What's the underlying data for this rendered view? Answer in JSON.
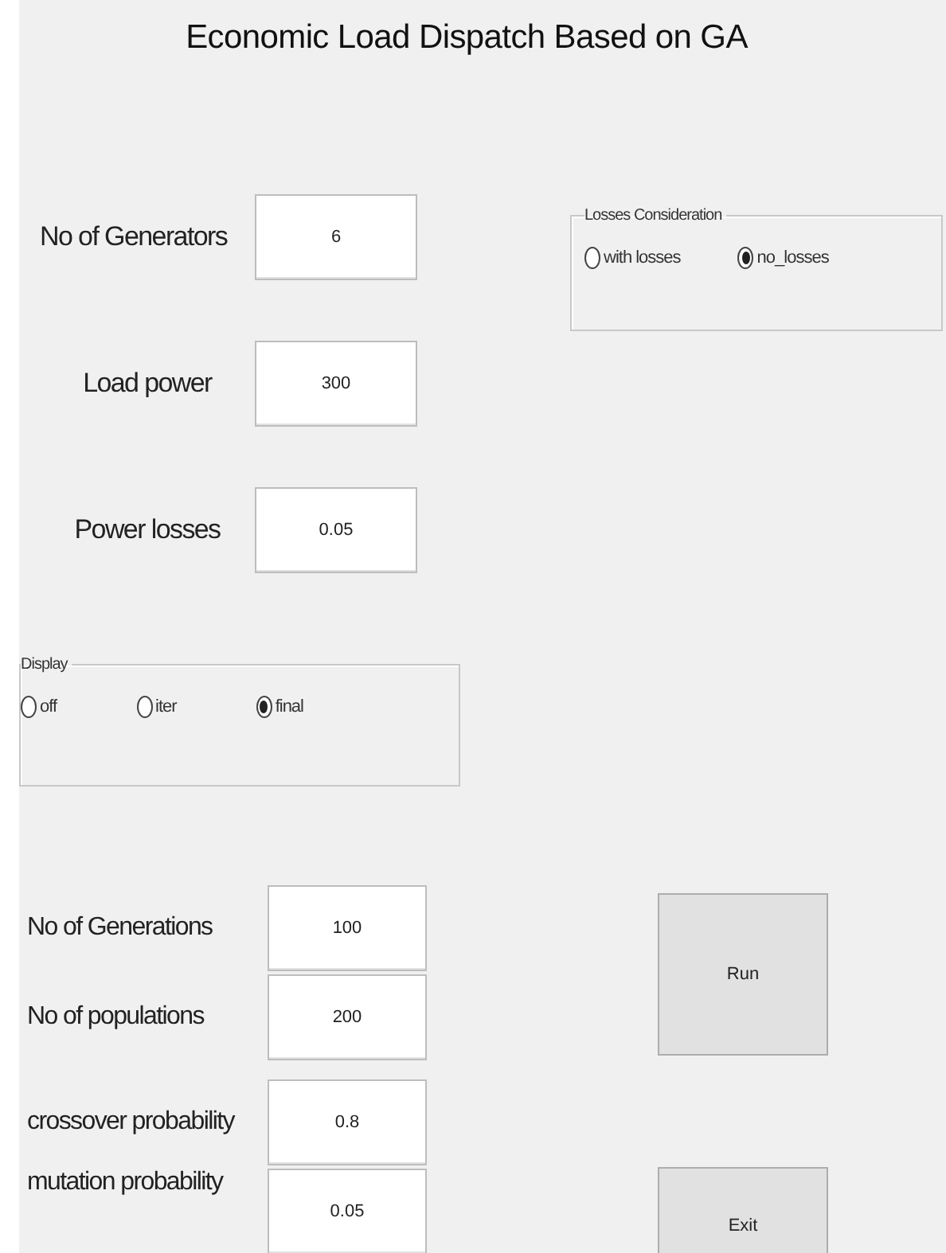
{
  "title": "Economic Load Dispatch Based on GA",
  "system_fields": [
    {
      "label": "No of Generators",
      "value": "6"
    },
    {
      "label": "Load power",
      "value": "300"
    },
    {
      "label": "Power losses",
      "value": "0.05"
    }
  ],
  "losses_consideration": {
    "title": "Losses Consideration",
    "options": [
      {
        "label": "with losses",
        "selected": false
      },
      {
        "label": "no_losses",
        "selected": true
      }
    ]
  },
  "display": {
    "title": "Display",
    "options": [
      {
        "label": "off",
        "selected": false
      },
      {
        "label": "iter",
        "selected": false
      },
      {
        "label": "final",
        "selected": true
      }
    ]
  },
  "ga_fields": [
    {
      "label": "No of Generations",
      "value": "100"
    },
    {
      "label": "No of populations",
      "value": "200"
    },
    {
      "label": "crossover probability",
      "value": "0.8"
    },
    {
      "label": "mutation probability",
      "value": "0.05"
    }
  ],
  "buttons": [
    "Run",
    "Exit"
  ]
}
